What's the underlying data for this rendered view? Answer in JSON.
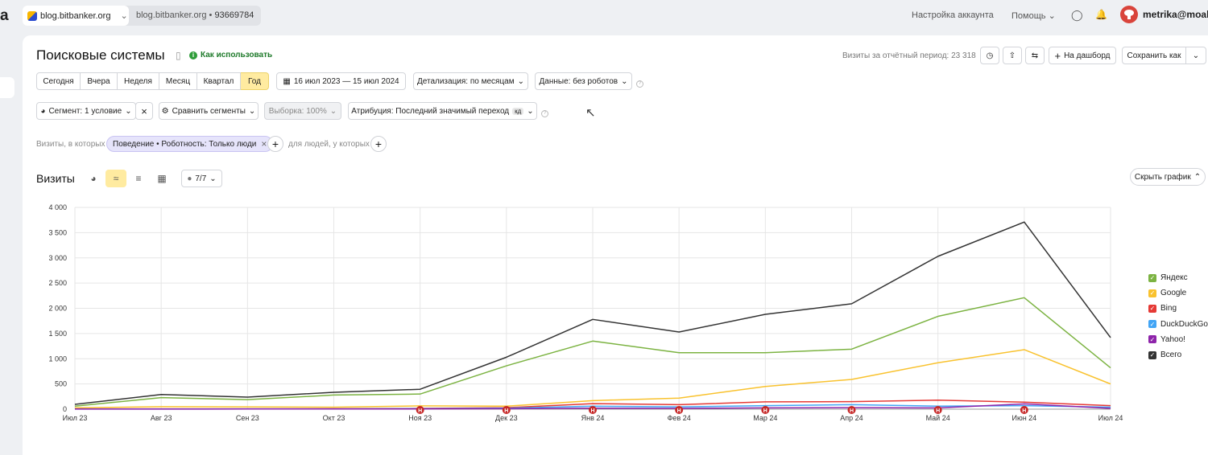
{
  "topbar": {
    "logo_fragment": "a",
    "site_main": "blog.bitbanker.org",
    "site_secondary": "blog.bitbanker.org",
    "counter_id": "93669784",
    "account_settings": "Настройка аккаунта",
    "help": "Помощь",
    "user": "metrika@moab.p"
  },
  "header": {
    "title": "Поисковые системы",
    "how_to": "Как использовать",
    "visits_total": "Визиты за отчётный период: 23 318",
    "to_dashboard": "На дашборд",
    "save_as": "Сохранить как"
  },
  "periods": [
    "Сегодня",
    "Вчера",
    "Неделя",
    "Месяц",
    "Квартал",
    "Год"
  ],
  "date_range": "16 июл 2023 — 15 июл 2024",
  "detail": "Детализация: по месяцам",
  "data_filter": "Данные: без роботов",
  "segment_row": {
    "segment": "Сегмент: 1 условие",
    "compare": "Сравнить сегменты",
    "sample": "Выборка: 100%",
    "attribution": "Атрибуция: Последний значимый переход",
    "attribution_badge": "кд"
  },
  "filter_row": {
    "visits_where": "Визиты, в которых",
    "chip": "Поведение • Роботность: Только люди",
    "people_where": "для людей, у которых"
  },
  "chart_header": {
    "title": "Визиты",
    "series_count": "7/7",
    "hide_chart": "Скрыть график"
  },
  "annotation_marker": "Н",
  "chart_data": {
    "type": "line",
    "x": [
      "Июл 23",
      "Авг 23",
      "Сен 23",
      "Окт 23",
      "Ноя 23",
      "Дек 23",
      "Янв 24",
      "Фев 24",
      "Мар 24",
      "Апр 24",
      "Май 24",
      "Июн 24",
      "Июл 24"
    ],
    "ylim": [
      0,
      4000
    ],
    "yticks": [
      "0",
      "500",
      "1 000",
      "1 500",
      "2 000",
      "2 500",
      "3 000",
      "3 500",
      "4 000"
    ],
    "grid": true,
    "legend_position": "right",
    "series": [
      {
        "name": "Яндекс",
        "color": "#7cb342",
        "values": [
          60,
          230,
          190,
          280,
          300,
          860,
          1350,
          1120,
          1120,
          1190,
          1840,
          2210,
          820
        ]
      },
      {
        "name": "Google",
        "color": "#f9c22e",
        "values": [
          25,
          50,
          45,
          40,
          65,
          60,
          170,
          220,
          450,
          590,
          920,
          1180,
          500
        ]
      },
      {
        "name": "Bing",
        "color": "#e53935",
        "values": [
          5,
          5,
          5,
          10,
          15,
          30,
          110,
          90,
          145,
          150,
          180,
          140,
          70
        ]
      },
      {
        "name": "DuckDuckGo",
        "color": "#42a5f5",
        "values": [
          3,
          3,
          5,
          5,
          10,
          20,
          60,
          45,
          70,
          90,
          60,
          70,
          40
        ]
      },
      {
        "name": "Yahoo!",
        "color": "#8e24aa",
        "values": [
          2,
          2,
          3,
          3,
          5,
          10,
          20,
          15,
          25,
          30,
          25,
          105,
          15
        ]
      },
      {
        "name": "Всего",
        "color": "#333333",
        "values": [
          95,
          290,
          240,
          335,
          395,
          1030,
          1780,
          1530,
          1880,
          2090,
          3030,
          3710,
          1420
        ]
      }
    ],
    "annotations_at": [
      "Ноя 23",
      "Дек 23",
      "Янв 24",
      "Фев 24",
      "Мар 24",
      "Апр 24",
      "Май 24",
      "Июн 24"
    ]
  }
}
